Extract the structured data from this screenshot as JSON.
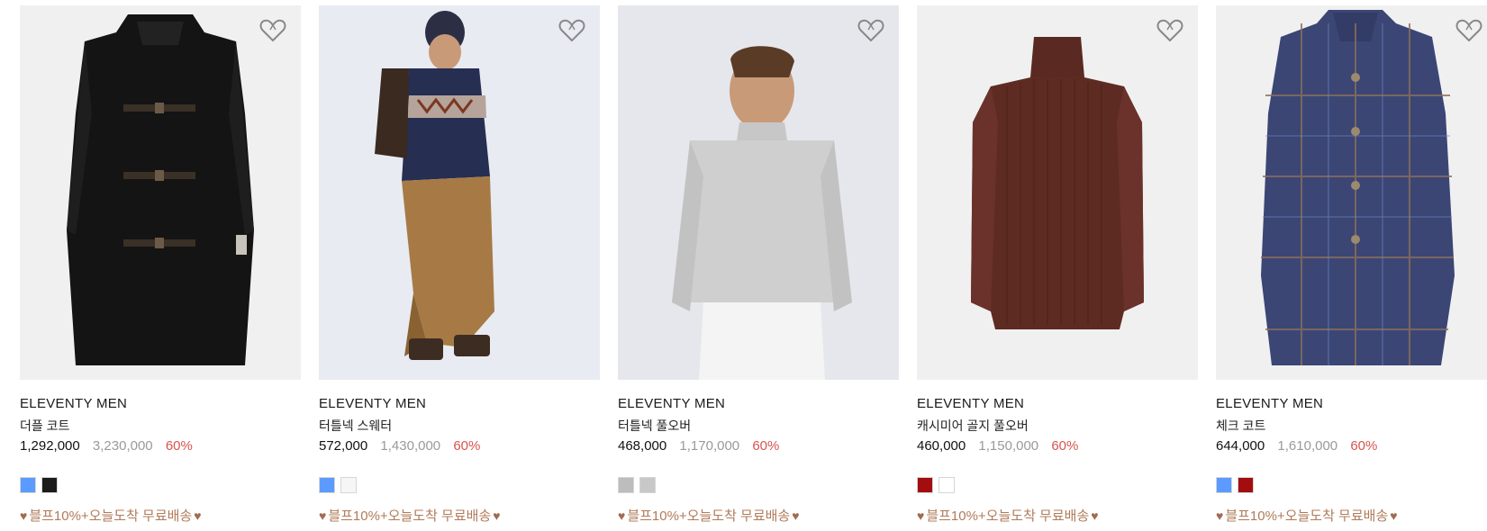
{
  "products": [
    {
      "brand": "ELEVENTY MEN",
      "name": "더플 코트",
      "price": "1,292,000",
      "original_price": "3,230,000",
      "discount": "60%",
      "swatches": [
        "#5b9bff",
        "#1c1c1c"
      ],
      "promo": "블프10%+오늘도착 무료배송"
    },
    {
      "brand": "ELEVENTY MEN",
      "name": "터틀넥 스웨터",
      "price": "572,000",
      "original_price": "1,430,000",
      "discount": "60%",
      "swatches": [
        "#5b9bff",
        "#f6f6f6"
      ],
      "promo": "블프10%+오늘도착 무료배송"
    },
    {
      "brand": "ELEVENTY MEN",
      "name": "터틀넥 풀오버",
      "price": "468,000",
      "original_price": "1,170,000",
      "discount": "60%",
      "swatches": [
        "#bdbdbd",
        "#c8c8c8"
      ],
      "promo": "블프10%+오늘도착 무료배송"
    },
    {
      "brand": "ELEVENTY MEN",
      "name": "캐시미어 골지 풀오버",
      "price": "460,000",
      "original_price": "1,150,000",
      "discount": "60%",
      "swatches": [
        "#a30d0d",
        "#ffffff"
      ],
      "promo": "블프10%+오늘도착 무료배송"
    },
    {
      "brand": "ELEVENTY MEN",
      "name": "체크 코트",
      "price": "644,000",
      "original_price": "1,610,000",
      "discount": "60%",
      "swatches": [
        "#5b9bff",
        "#a30d0d"
      ],
      "promo": "블프10%+오늘도착 무료배송"
    }
  ],
  "icons": {
    "wishlist": "heart-outline-icon",
    "promo": "heart-filled-icon"
  },
  "colors": {
    "discount": "#d9534f",
    "original_price": "#9a9a9a",
    "promo": "#b07b5a"
  }
}
